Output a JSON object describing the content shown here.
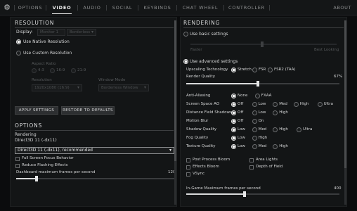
{
  "nav": {
    "tabs": [
      "OPTIONS",
      "VIDEO",
      "AUDIO",
      "SOCIAL",
      "KEYBINDS",
      "CHAT WHEEL",
      "CONTROLLER"
    ],
    "active": "VIDEO",
    "about": "ABOUT"
  },
  "resolution": {
    "title": "RESOLUTION",
    "display_label": "Display:",
    "display_values": [
      "Monitor 1",
      "Borderless"
    ],
    "native_label": "Use Native Resolution",
    "custom_label": "Use Custom Resolution",
    "aspect_label": "Aspect Ratio",
    "aspect_options": [
      "4:3",
      "16:9",
      "21:9"
    ],
    "resolution_label": "Resolution",
    "resolution_value": "1920x1080 (16:9)",
    "window_mode_label": "Window Mode",
    "window_mode_value": "Borderless Window",
    "apply_button": "APPLY SETTINGS",
    "restore_button": "RESTORE TO DEFAULTS"
  },
  "options": {
    "title": "OPTIONS",
    "rendering_label": "Rendering",
    "rendering_api": "Direct3D 11 (-dx11)",
    "api_select": "Direct3D 11 (-dx11), recommended",
    "checks": [
      "Full Screen Focus Behavior",
      "Reduce Flashing Effects"
    ],
    "fps_label": "Dashboard maximum frames per second",
    "fps_value": "120",
    "fps_fraction": 0.13
  },
  "rendering": {
    "title": "RENDERING",
    "basic_label": "Use basic settings",
    "basic_left": "Faster",
    "basic_right": "Best Looking",
    "advanced_label": "Use advanced settings",
    "upscaling_label": "Upscaling Technology",
    "upscaling_options": [
      "Stretch",
      "FSR",
      "FSR2 (TAA)"
    ],
    "render_quality_label": "Render Quality",
    "render_quality_value": "67%",
    "render_quality_fraction": 0.47,
    "rows": [
      {
        "label": "Anti-Aliasing",
        "options": [
          "None",
          "FXAA"
        ],
        "selected": 0
      },
      {
        "label": "Screen Space AO",
        "options": [
          "Off",
          "Low",
          "Med",
          "High",
          "Ultra"
        ],
        "selected": 0
      },
      {
        "label": "Distance Field Shadows",
        "options": [
          "Off",
          "Low",
          "High"
        ],
        "selected": 0
      },
      {
        "label": "Motion Blur",
        "options": [
          "Off",
          "On"
        ],
        "selected": 0
      },
      {
        "label": "Shadow Quality",
        "options": [
          "Low",
          "Med",
          "High",
          "Ultra"
        ],
        "selected": 0
      },
      {
        "label": "Fog Quality",
        "options": [
          "Low",
          "High"
        ],
        "selected": 0
      },
      {
        "label": "Texture Quality",
        "options": [
          "Low",
          "Med",
          "High"
        ],
        "selected": 0
      }
    ],
    "checks": [
      "Post Process Bloom",
      "Area Lights",
      "Effects Bloom",
      "Depth of Field",
      "VSync"
    ],
    "ingame_fps_label": "In-Game Maximum frames per second",
    "ingame_fps_value": "400",
    "ingame_fps_fraction": 0.38
  }
}
